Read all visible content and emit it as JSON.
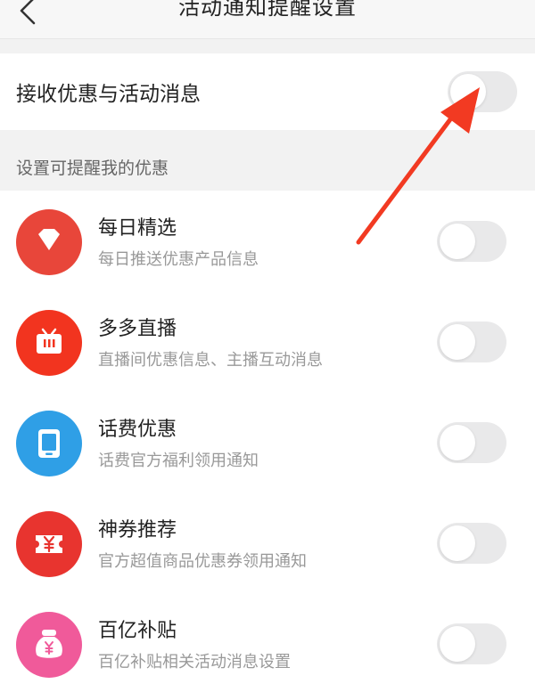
{
  "header": {
    "title": "活动通知提醒设置",
    "back_icon": "chevron-left-icon"
  },
  "main_setting": {
    "label": "接收优惠与活动消息",
    "enabled": false
  },
  "section": {
    "title": "设置可提醒我的优惠"
  },
  "items": [
    {
      "name": "每日精选",
      "desc": "每日推送优惠产品信息",
      "icon": "diamond-icon",
      "color": "#e8463a",
      "enabled": false
    },
    {
      "name": "多多直播",
      "desc": "直播间优惠信息、主播互动消息",
      "icon": "tv-icon",
      "color": "#f2341f",
      "enabled": false
    },
    {
      "name": "话费优惠",
      "desc": "话费官方福利领用通知",
      "icon": "tablet-icon",
      "color": "#2f9fe6",
      "enabled": false
    },
    {
      "name": "神券推荐",
      "desc": "官方超值商品优惠券领用通知",
      "icon": "coupon-icon",
      "color": "#e8342f",
      "enabled": false
    },
    {
      "name": "百亿补贴",
      "desc": "百亿补贴相关活动消息设置",
      "icon": "money-bag-icon",
      "color": "#f05a9a",
      "enabled": false
    }
  ],
  "colors": {
    "arrow": "#f23a22",
    "toggle_off": "#e9e9ea"
  }
}
